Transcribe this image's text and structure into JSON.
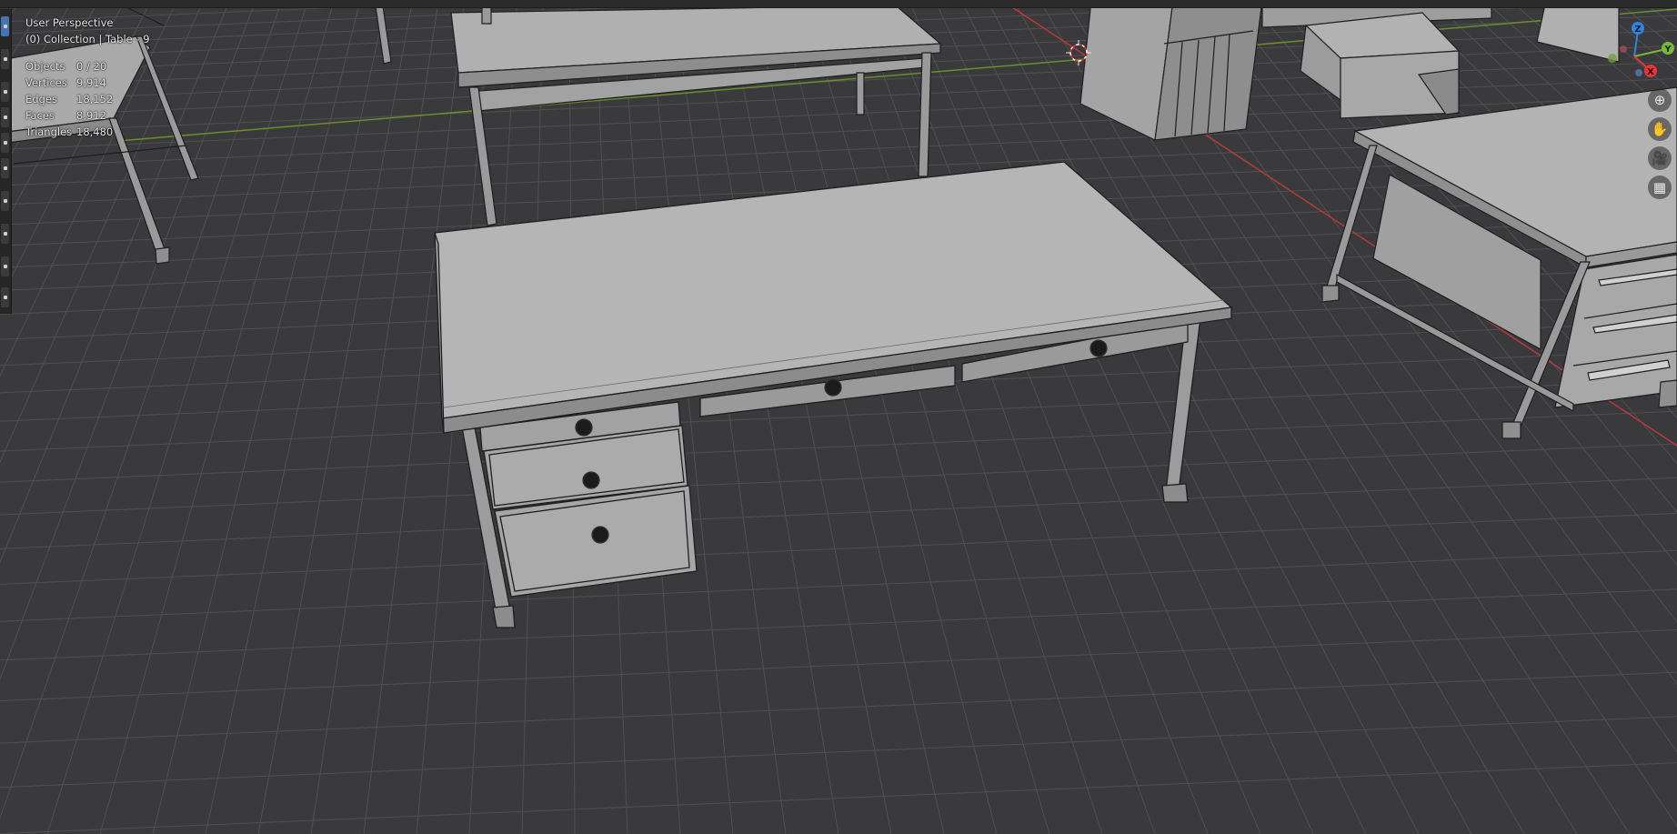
{
  "viewport": {
    "view_name": "User Perspective",
    "collection_info": "(0) Collection | Table - 9",
    "stats": [
      {
        "label": "Objects",
        "value": "0 / 20"
      },
      {
        "label": "Vertices",
        "value": "9,914"
      },
      {
        "label": "Edges",
        "value": "18,152"
      },
      {
        "label": "Faces",
        "value": "8,912"
      },
      {
        "label": "Triangles",
        "value": "18,480"
      }
    ]
  },
  "gizmo": {
    "z_label": "Z",
    "y_label": "Y",
    "x_label": "X",
    "colors": {
      "x": "#e8333b",
      "y": "#78b83a",
      "z": "#2f84e0"
    }
  },
  "right_nav": [
    {
      "icon": "zoom-icon",
      "glyph": "⊕"
    },
    {
      "icon": "pan-hand-icon",
      "glyph": "✋"
    },
    {
      "icon": "camera-icon",
      "glyph": "🎥"
    },
    {
      "icon": "perspective-grid-icon",
      "glyph": "▦"
    }
  ],
  "colors": {
    "background": "#3a3a3c",
    "grid_line": "#505053",
    "x_axis": "#b83a3a",
    "y_axis": "#6a8e2c",
    "object_light": "#b4b4b4",
    "object_mid": "#9c9c9c",
    "object_dark": "#7c7c7c",
    "wire": "#1e1e1e"
  }
}
